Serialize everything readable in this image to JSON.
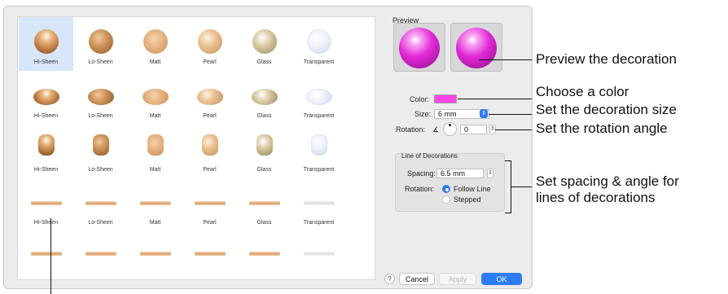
{
  "grid": {
    "rows": [
      {
        "shape": "sphere",
        "labels": [
          "Hi-Sheen",
          "Lo-Sheen",
          "Matt",
          "Pearl",
          "Glass",
          "Transparent"
        ]
      },
      {
        "shape": "flat",
        "labels": [
          "Hi-Sheen",
          "Lo-Sheen",
          "Matt",
          "Pearl",
          "Glass",
          "Transparent"
        ]
      },
      {
        "shape": "pill",
        "labels": [
          "Hi-Sheen",
          "Lo-Sheen",
          "Matt",
          "Pearl",
          "Glass",
          "Transparent"
        ]
      },
      {
        "shape": "bar",
        "labels": [
          "Hi-Sheen",
          "Lo-Sheen",
          "Matt",
          "Pearl",
          "Glass",
          "Transparent"
        ]
      },
      {
        "shape": "bar",
        "labels": [
          "",
          "",
          "",
          "",
          "",
          ""
        ]
      }
    ],
    "selected": {
      "row": 0,
      "col": 0
    }
  },
  "preview": {
    "label": "Preview"
  },
  "color": {
    "label": "Color:",
    "value": "#ff44e6"
  },
  "size": {
    "label": "Size:",
    "value": "6 mm"
  },
  "rotation": {
    "label": "Rotation:",
    "symbol": "∡",
    "value": "0"
  },
  "line_group": {
    "title": "Line of Decorations",
    "spacing_label": "Spacing:",
    "spacing_value": "6.5 mm",
    "rotation_label": "Rotation:",
    "options": [
      "Follow Line",
      "Stepped"
    ],
    "selected_option": "Follow Line"
  },
  "buttons": {
    "help": "?",
    "cancel": "Cancel",
    "apply": "Apply",
    "ok": "OK"
  },
  "annotations": {
    "preview": "Preview the decoration",
    "color": "Choose a color",
    "size": "Set the decoration size",
    "rotation": "Set the rotation angle",
    "spacing_line1": "Set spacing & angle for",
    "spacing_line2": "lines of decorations"
  }
}
